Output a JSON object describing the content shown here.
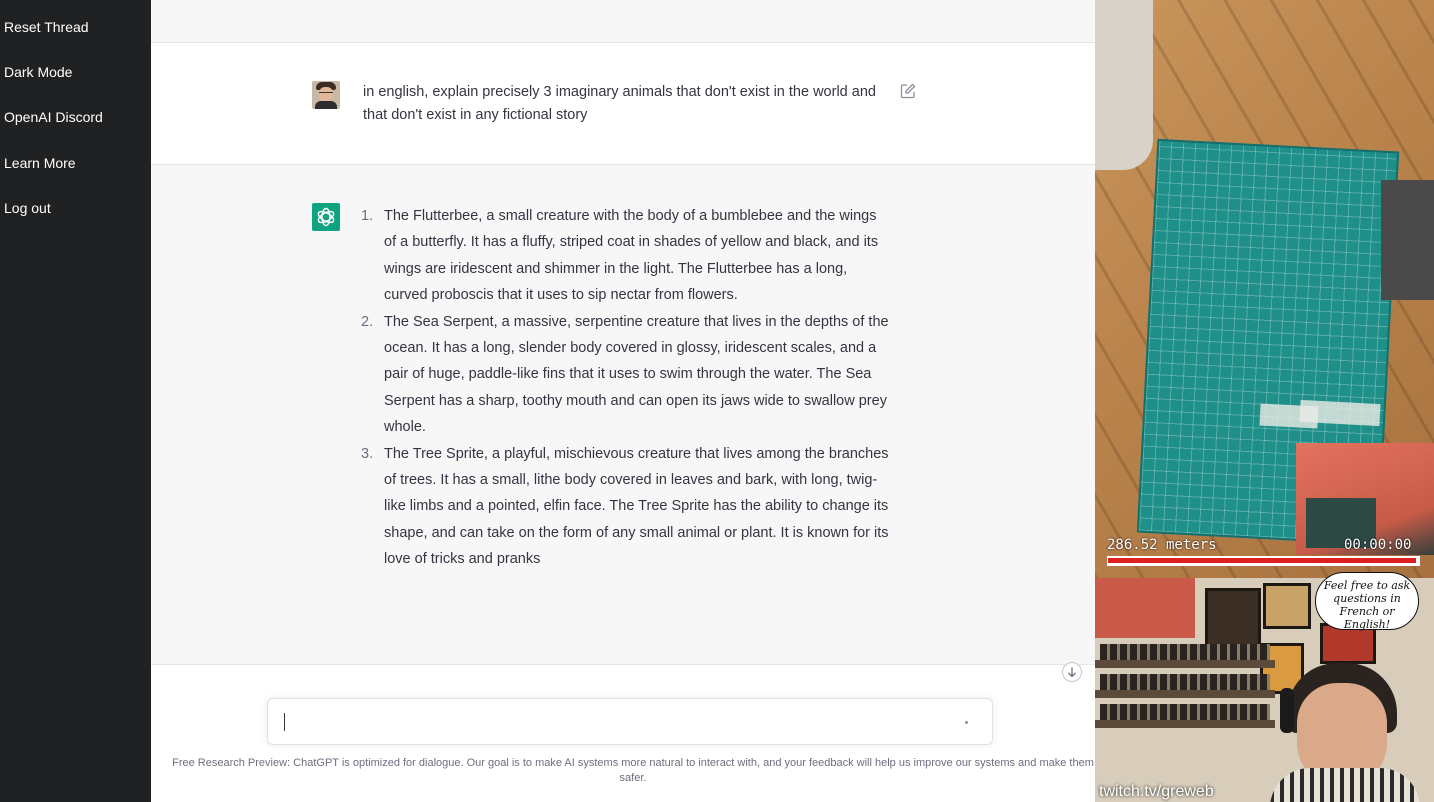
{
  "sidebar": {
    "items": [
      {
        "label": "Reset Thread"
      },
      {
        "label": "Dark Mode"
      },
      {
        "label": "OpenAI Discord"
      },
      {
        "label": "Learn More"
      },
      {
        "label": "Log out"
      }
    ]
  },
  "conversation": {
    "user_message": "in english, explain precisely 3 imaginary animals that don't exist in the world and that don't exist in any fictional story",
    "assistant_items": [
      {
        "num": "1.",
        "text": "The Flutterbee, a small creature with the body of a bumblebee and the wings of a butterfly. It has a fluffy, striped coat in shades of yellow and black, and its wings are iridescent and shimmer in the light. The Flutterbee has a long, curved proboscis that it uses to sip nectar from flowers."
      },
      {
        "num": "2.",
        "text": "The Sea Serpent, a massive, serpentine creature that lives in the depths of the ocean. It has a long, slender body covered in glossy, iridescent scales, and a pair of huge, paddle-like fins that it uses to swim through the water. The Sea Serpent has a sharp, toothy mouth and can open its jaws wide to swallow prey whole."
      },
      {
        "num": "3.",
        "text": "The Tree Sprite, a playful, mischievous creature that lives among the branches of trees. It has a small, lithe body covered in leaves and bark, with long, twig-like limbs and a pointed, elfin face. The Tree Sprite has the ability to change its shape, and can take on the form of any small animal or plant. It is known for its love of tricks and pranks"
      }
    ]
  },
  "composer": {
    "value": ""
  },
  "footer": {
    "text": "Free Research Preview: ChatGPT is optimized for dialogue. Our goal is to make AI systems more natural to interact with, and your feedback will help us improve our systems and make them safer."
  },
  "stream_overlay": {
    "distance": "286.52 meters",
    "timer": "00:00:00",
    "progress_fraction": 0.99,
    "speech_bubble": "Feel free to ask questions in French or English!",
    "watermark": "twitch.tv/greweb"
  },
  "colors": {
    "sidebar_bg": "#202123",
    "assistant_bg": "#f7f7f8",
    "brand_green": "#10a37f",
    "progress_red": "#e02020"
  },
  "icons": {
    "assistant_avatar": "openai-logo-icon",
    "edit": "edit-icon",
    "scroll": "arrow-down-icon"
  }
}
